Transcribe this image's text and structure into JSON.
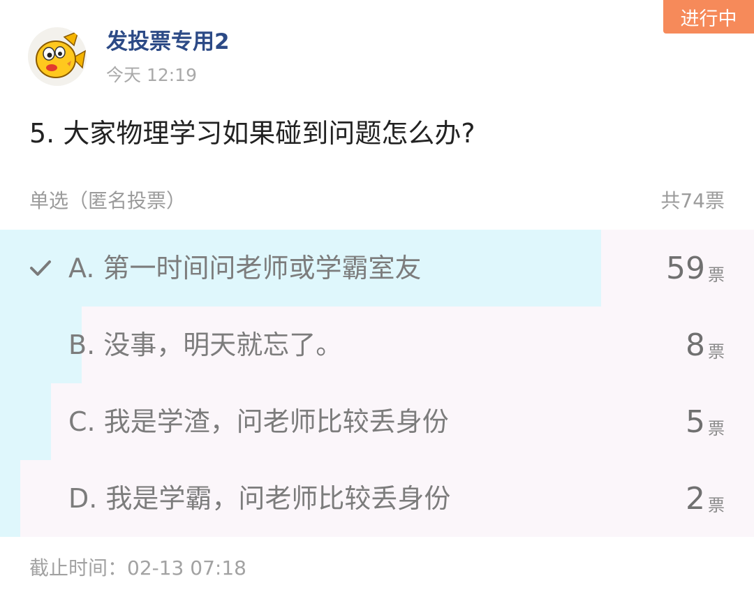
{
  "status": "进行中",
  "author": {
    "name": "发投票专用2",
    "time": "今天 12:19",
    "avatar_icon": "cartoon-fish-avatar"
  },
  "question": "5. 大家物理学习如果碰到问题怎么办?",
  "vote_type": "单选（匿名投票）",
  "total": "共74票",
  "options": [
    {
      "label": "A. 第一时间问老师或学霸室友",
      "count": "59",
      "unit": "票",
      "share": 0.797,
      "selected": true
    },
    {
      "label": "B. 没事，明天就忘了。",
      "count": "8",
      "unit": "票",
      "share": 0.108,
      "selected": false
    },
    {
      "label": "C. 我是学渣，问老师比较丢身份",
      "count": "5",
      "unit": "票",
      "share": 0.068,
      "selected": false
    },
    {
      "label": "D. 我是学霸，问老师比较丢身份",
      "count": "2",
      "unit": "票",
      "share": 0.027,
      "selected": false
    }
  ],
  "deadline": "截止时间：02-13 07:18",
  "colors": {
    "accent": "#f68a5a",
    "author": "#2c4a86",
    "bar_fill": "#dff7fc",
    "bar_bg": "#fbf6fa"
  }
}
